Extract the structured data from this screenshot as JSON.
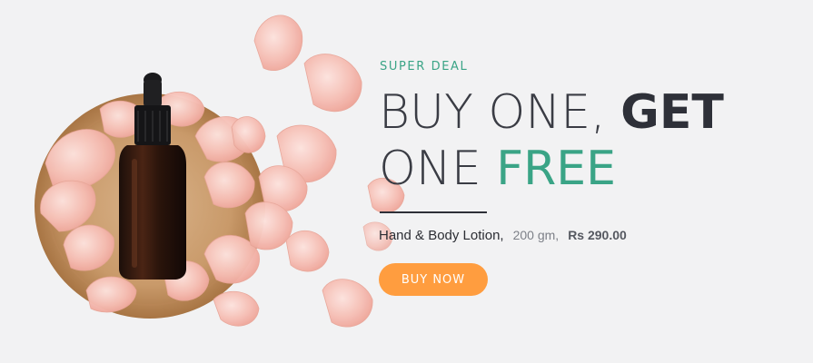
{
  "banner": {
    "eyebrow": "SUPER DEAL",
    "headline": {
      "line1_thin": "BUY ONE,",
      "line1_bold": "GET",
      "line2_thin": "ONE",
      "line2_accent": "FREE"
    },
    "product": "Hand & Body Lotion,",
    "weight": "200 gm,",
    "price": "Rs 290.00",
    "cta_label": "BUY NOW"
  },
  "colors": {
    "background": "#f2f2f3",
    "accent_green": "#3aa486",
    "button_orange": "#ff9d3f",
    "text_dark": "#2e3038"
  }
}
